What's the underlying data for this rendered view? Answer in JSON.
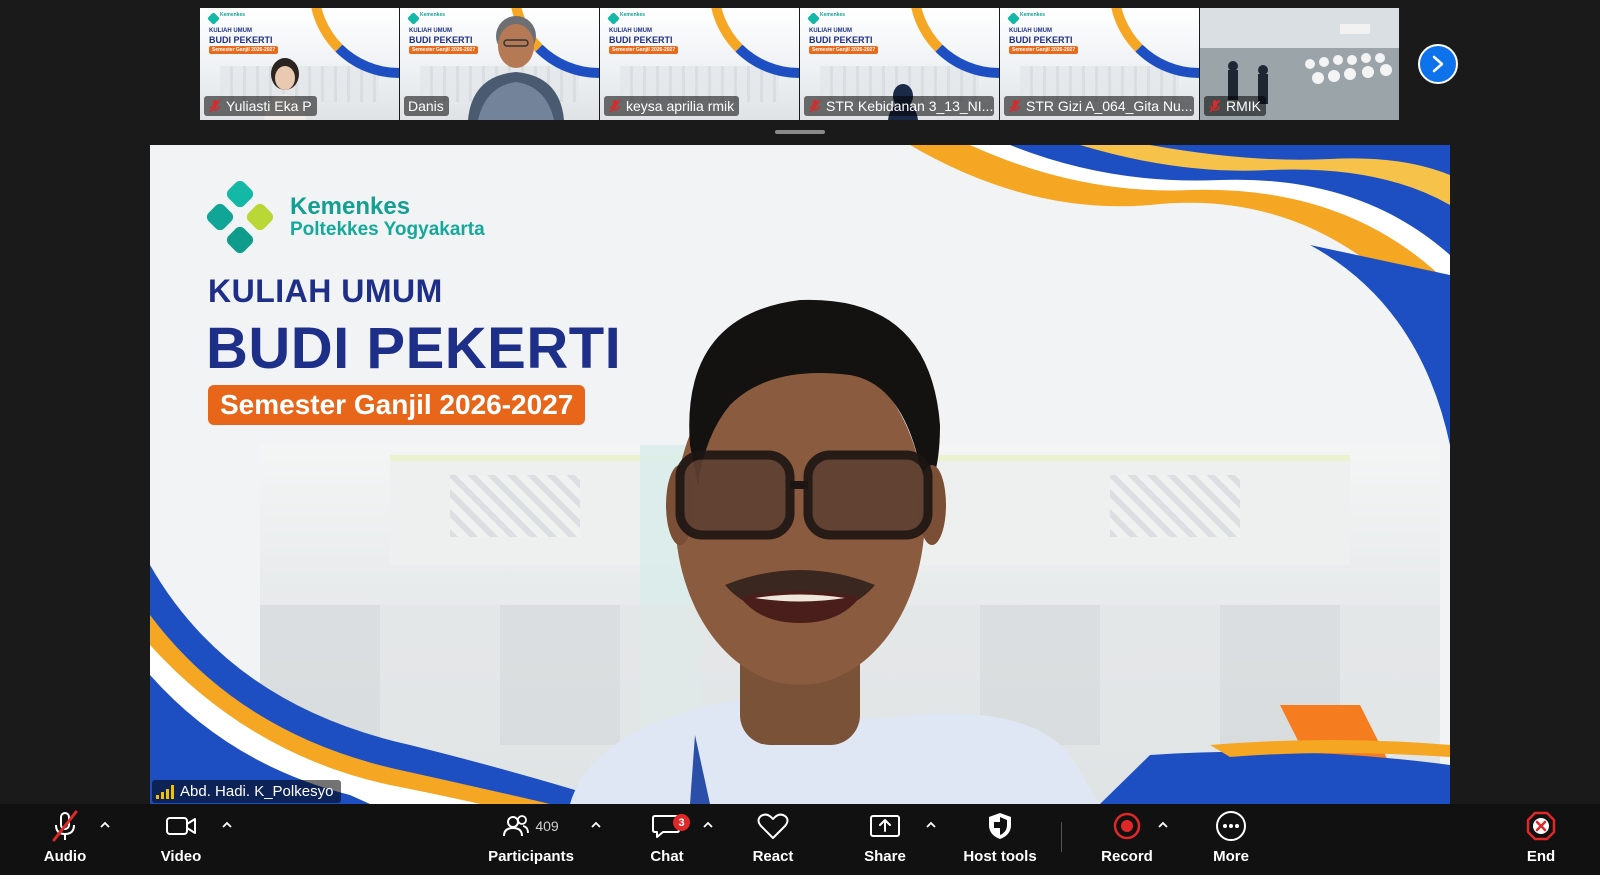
{
  "thumbnails": [
    {
      "name": "Yuliasti Eka P",
      "muted": true
    },
    {
      "name": "Danis",
      "muted": false
    },
    {
      "name": "keysa aprilia rmik",
      "muted": true
    },
    {
      "name": "STR Kebidanan 3_13_NI...",
      "muted": true
    },
    {
      "name": "STR Gizi A_064_Gita Nu...",
      "muted": true
    },
    {
      "name": "RMIK",
      "muted": true
    }
  ],
  "slide": {
    "brand_line1": "Kemenkes",
    "brand_line2": "Poltekkes Yogyakarta",
    "title_small": "KULIAH UMUM",
    "title_big": "BUDI PEKERTI",
    "subtitle": "Semester Ganjil 2026-2027",
    "thumb_subtitle": "Semester Ganjil 2026-2027"
  },
  "speaker": {
    "name": "Abd. Hadi. K_Polkesyo"
  },
  "toolbar": {
    "audio": "Audio",
    "video": "Video",
    "participants": "Participants",
    "participants_count": "409",
    "chat": "Chat",
    "chat_badge": "3",
    "react": "React",
    "share": "Share",
    "host_tools": "Host tools",
    "record": "Record",
    "more": "More",
    "end": "End"
  },
  "colors": {
    "accent_blue": "#0e72ed",
    "end_red": "#e02828",
    "slide_navy": "#1e2f8a",
    "slide_orange": "#e8661a",
    "slide_teal": "#149f93"
  }
}
